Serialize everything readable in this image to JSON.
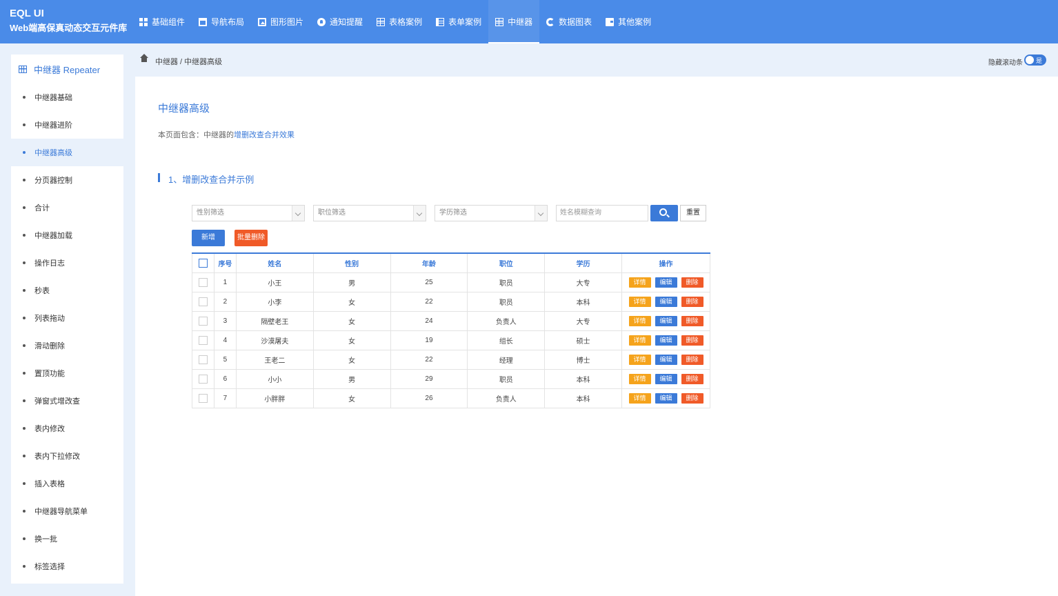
{
  "brand": {
    "title": "EQL UI",
    "subtitle": "Web端高保真动态交互元件库"
  },
  "nav": [
    {
      "label": "基础组件",
      "icon": "grid-icon"
    },
    {
      "label": "导航布局",
      "icon": "layout-icon"
    },
    {
      "label": "图形图片",
      "icon": "image-icon"
    },
    {
      "label": "通知提醒",
      "icon": "bell-icon"
    },
    {
      "label": "表格案例",
      "icon": "table-icon"
    },
    {
      "label": "表单案例",
      "icon": "form-icon"
    },
    {
      "label": "中继器",
      "icon": "table-icon",
      "active": true
    },
    {
      "label": "数据图表",
      "icon": "chart-icon"
    },
    {
      "label": "其他案例",
      "icon": "wallet-icon"
    }
  ],
  "sidebar": {
    "title": "中继器 Repeater",
    "items": [
      "中继器基础",
      "中继器进阶",
      "中继器高级",
      "分页器控制",
      "合计",
      "中继器加载",
      "操作日志",
      "秒表",
      "列表拖动",
      "滑动删除",
      "置顶功能",
      "弹窗式增改查",
      "表内修改",
      "表内下拉修改",
      "插入表格",
      "中继器导航菜单",
      "换一批",
      "标签选择"
    ],
    "active_index": 2
  },
  "breadcrumb": "中继器 / 中继器高级",
  "toggle": {
    "label": "隐藏滚动条",
    "value": "是"
  },
  "page": {
    "title": "中继器高级",
    "desc_prefix": "本页面包含：中继器的",
    "desc_link": "增删改查合并效果",
    "section_title": "1、增删改查合并示例"
  },
  "filters": {
    "gender_placeholder": "性别筛选",
    "position_placeholder": "职位筛选",
    "education_placeholder": "学历筛选",
    "name_placeholder": "姓名模糊查询",
    "reset_label": "重置"
  },
  "actions": {
    "add_label": "新增",
    "batch_delete_label": "批量删除"
  },
  "table": {
    "headers": [
      "序号",
      "姓名",
      "性别",
      "年龄",
      "职位",
      "学历",
      "操作"
    ],
    "op_labels": {
      "detail": "详情",
      "edit": "编辑",
      "delete": "删除"
    },
    "rows": [
      [
        "1",
        "小王",
        "男",
        "25",
        "职员",
        "大专"
      ],
      [
        "2",
        "小李",
        "女",
        "22",
        "职员",
        "本科"
      ],
      [
        "3",
        "隔壁老王",
        "女",
        "24",
        "负责人",
        "大专"
      ],
      [
        "4",
        "沙漠屠夫",
        "女",
        "19",
        "组长",
        "硕士"
      ],
      [
        "5",
        "王老二",
        "女",
        "22",
        "经理",
        "博士"
      ],
      [
        "6",
        "小小",
        "男",
        "29",
        "职员",
        "本科"
      ],
      [
        "7",
        "小胖胖",
        "女",
        "26",
        "负责人",
        "本科"
      ]
    ]
  }
}
